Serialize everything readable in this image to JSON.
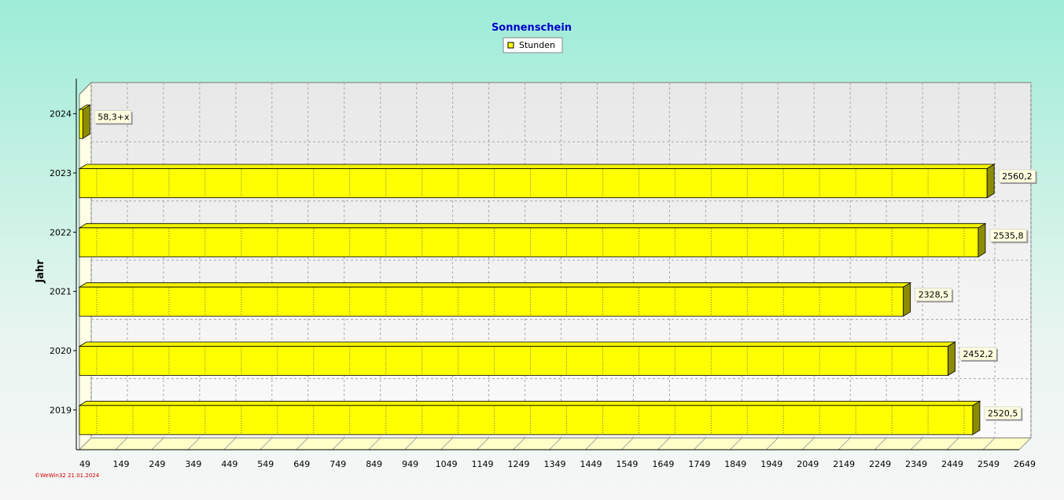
{
  "chart_data": {
    "type": "bar",
    "orientation": "horizontal",
    "title": "Sonnenschein",
    "ylabel": "Jahr",
    "xlabel": "",
    "categories": [
      "2019",
      "2020",
      "2021",
      "2022",
      "2023",
      "2024"
    ],
    "series": [
      {
        "name": "Stunden",
        "values": [
          2520.5,
          2452.2,
          2328.5,
          2535.8,
          2560.2,
          58.3
        ],
        "labels": [
          "2520,5",
          "2452,2",
          "2328,5",
          "2535,8",
          "2560,2",
          "58,3+x"
        ]
      }
    ],
    "xlim": [
      49,
      2649
    ],
    "xticks": [
      49,
      149,
      249,
      349,
      449,
      549,
      649,
      749,
      849,
      949,
      1049,
      1149,
      1249,
      1349,
      1449,
      1549,
      1649,
      1749,
      1849,
      1949,
      2049,
      2149,
      2249,
      2349,
      2449,
      2549,
      2649
    ],
    "grid": true,
    "legend_position": "top-center",
    "colors": {
      "bar_front": "#ffff00",
      "bar_top": "#f2f200",
      "bar_side": "#8c8c00",
      "title": "#0000cc"
    },
    "credit": "©WeWin32  21.01.2024"
  }
}
